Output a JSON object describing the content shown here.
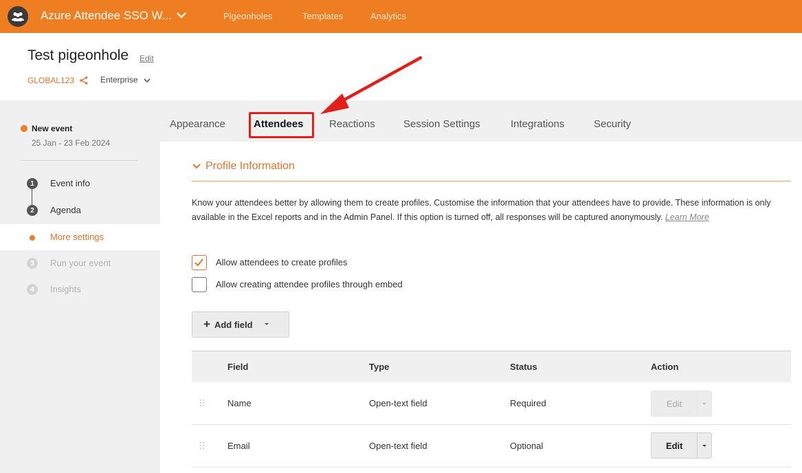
{
  "topbar": {
    "app_title": "Azure Attendee SSO W...",
    "nav": [
      "Pigeonholes",
      "Templates",
      "Analytics"
    ]
  },
  "header": {
    "title": "Test pigeonhole",
    "edit_label": "Edit",
    "code": "GLOBAL123",
    "plan": "Enterprise"
  },
  "sidebar": {
    "event_name": "New event",
    "event_dates": "25 Jan - 23 Feb 2024",
    "steps": [
      {
        "num": "1",
        "label": "Event info",
        "state": "done"
      },
      {
        "num": "2",
        "label": "Agenda",
        "state": "done"
      },
      {
        "num": "",
        "label": "More settings",
        "state": "active"
      },
      {
        "num": "3",
        "label": "Run your event",
        "state": "disabled"
      },
      {
        "num": "4",
        "label": "Insights",
        "state": "disabled"
      }
    ]
  },
  "tabs": [
    "Appearance",
    "Attendees",
    "Reactions",
    "Session Settings",
    "Integrations",
    "Security"
  ],
  "active_tab": "Attendees",
  "section": {
    "title": "Profile Information",
    "description": "Know your attendees better by allowing them to create profiles. Customise the information that your attendees have to provide. These information is only available in the Excel reports and in the Admin Panel. If this option is turned off, all responses will be captured anonymously.",
    "learn_more": "Learn More",
    "checkboxes": [
      {
        "label": "Allow attendees to create profiles",
        "checked": true
      },
      {
        "label": "Allow creating attendee profiles through embed",
        "checked": false
      }
    ],
    "add_field_label": "Add field"
  },
  "table": {
    "headers": [
      "Field",
      "Type",
      "Status",
      "Action"
    ],
    "rows": [
      {
        "field": "Name",
        "type": "Open-text field",
        "status": "Required",
        "action": "Edit",
        "enabled": false
      },
      {
        "field": "Email",
        "type": "Open-text field",
        "status": "Optional",
        "action": "Edit",
        "enabled": true
      }
    ]
  },
  "colors": {
    "brand": "#ef7d22",
    "accent_text": "#e8732b",
    "highlight": "#e0201b"
  }
}
